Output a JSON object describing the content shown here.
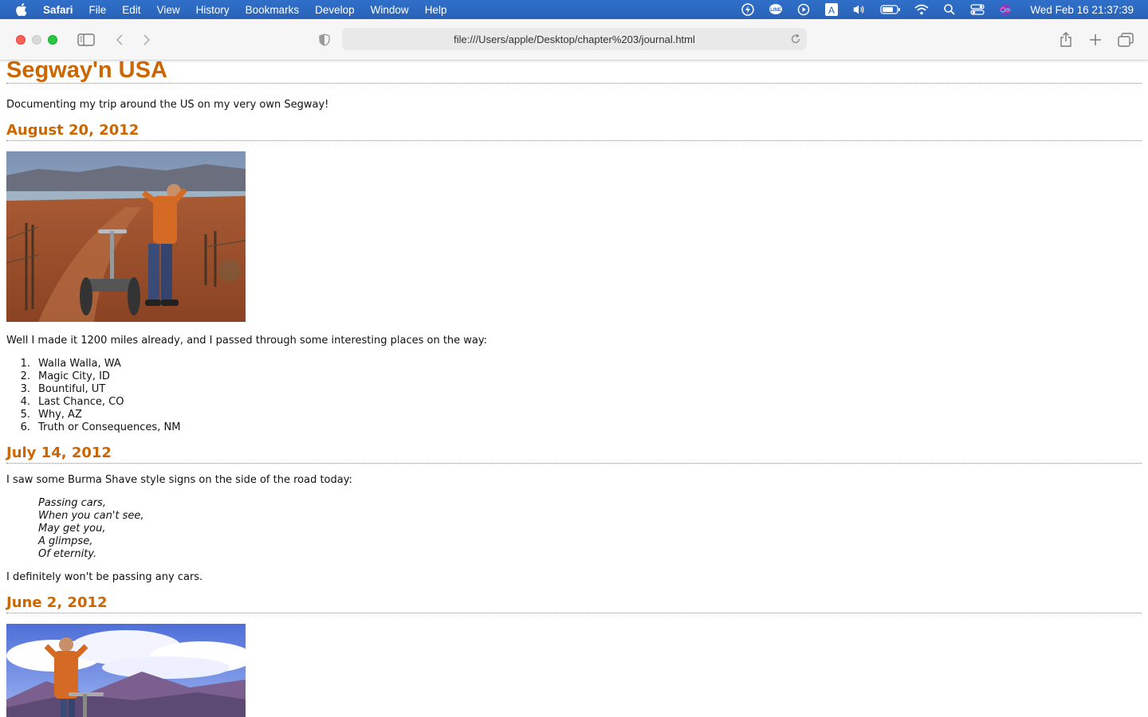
{
  "menubar": {
    "app_name": "Safari",
    "items": [
      "File",
      "Edit",
      "View",
      "History",
      "Bookmarks",
      "Develop",
      "Window",
      "Help"
    ],
    "clock": "Wed Feb 16  21:37:39",
    "status_icons": [
      "bolt-icon",
      "line-icon",
      "play-icon",
      "keyboard-a-icon",
      "volume-icon",
      "battery-icon",
      "wifi-icon",
      "search-icon",
      "control-center-icon",
      "siri-icon"
    ]
  },
  "toolbar": {
    "url": "file:///Users/apple/Desktop/chapter%203/journal.html"
  },
  "page": {
    "title": "Segway'n USA",
    "intro": "Documenting my trip around the US on my very own Segway!",
    "entries": [
      {
        "date": "August 20, 2012",
        "photo": "desert-segway-photo",
        "text": "Well I made it 1200 miles already, and I passed through some interesting places on the way:",
        "places": [
          {
            "num": "1.",
            "name": "Walla Walla, WA"
          },
          {
            "num": "2.",
            "name": "Magic City, ID"
          },
          {
            "num": "3.",
            "name": "Bountiful, UT"
          },
          {
            "num": "4.",
            "name": "Last Chance, CO"
          },
          {
            "num": "5.",
            "name": "Why, AZ"
          },
          {
            "num": "6.",
            "name": "Truth or Consequences, NM"
          }
        ]
      },
      {
        "date": "July 14, 2012",
        "text": "I saw some Burma Shave style signs on the side of the road today:",
        "verse": [
          "Passing cars,",
          "When you can't see,",
          "May get you,",
          "A glimpse,",
          "Of eternity."
        ],
        "closing": "I definitely won't be passing any cars."
      },
      {
        "date": "June 2, 2012",
        "photo": "mountain-segway-photo"
      }
    ]
  },
  "colors": {
    "heading": "#cc6600",
    "menubar": "#2a63b8"
  }
}
